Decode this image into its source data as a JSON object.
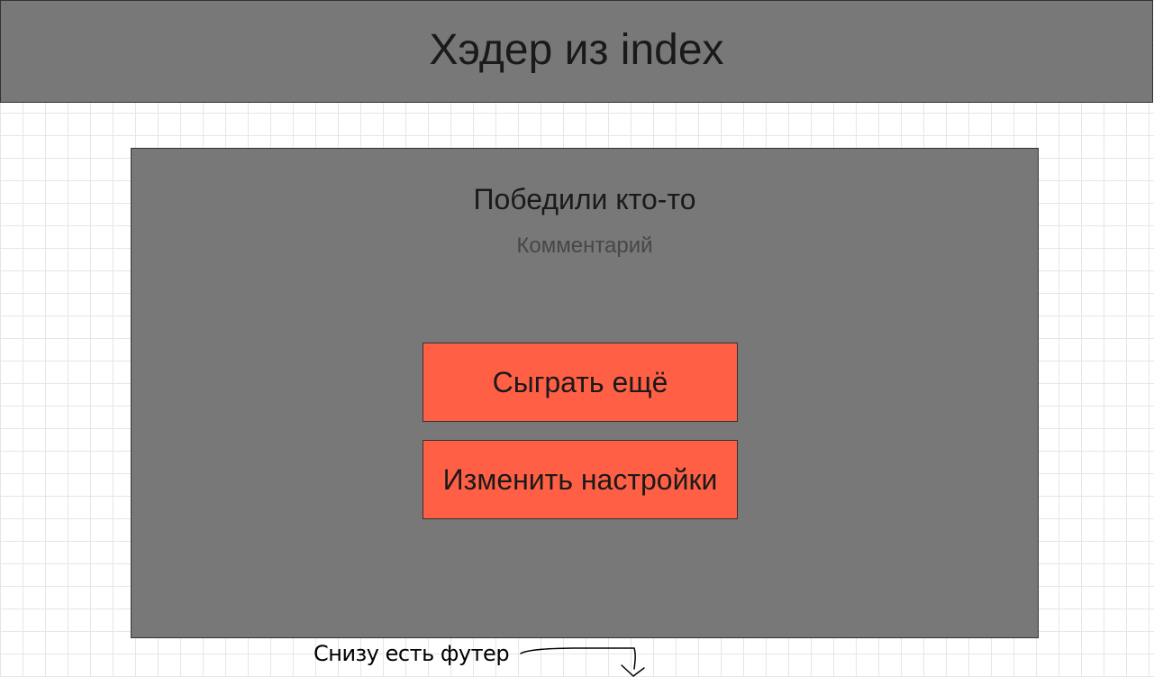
{
  "header": {
    "title": "Хэдер из index"
  },
  "result": {
    "title": "Победили кто-то",
    "comment": "Комментарий"
  },
  "buttons": {
    "play_again": "Сыграть ещё",
    "change_settings": "Изменить настройки"
  },
  "annotation": {
    "text": "Снизу есть футер"
  },
  "colors": {
    "panel": "#787878",
    "button": "#ff5f45",
    "text": "#1a1a1a",
    "comment": "#474747"
  },
  "icons": {
    "annotation_arrow": "arrow-down-icon"
  }
}
